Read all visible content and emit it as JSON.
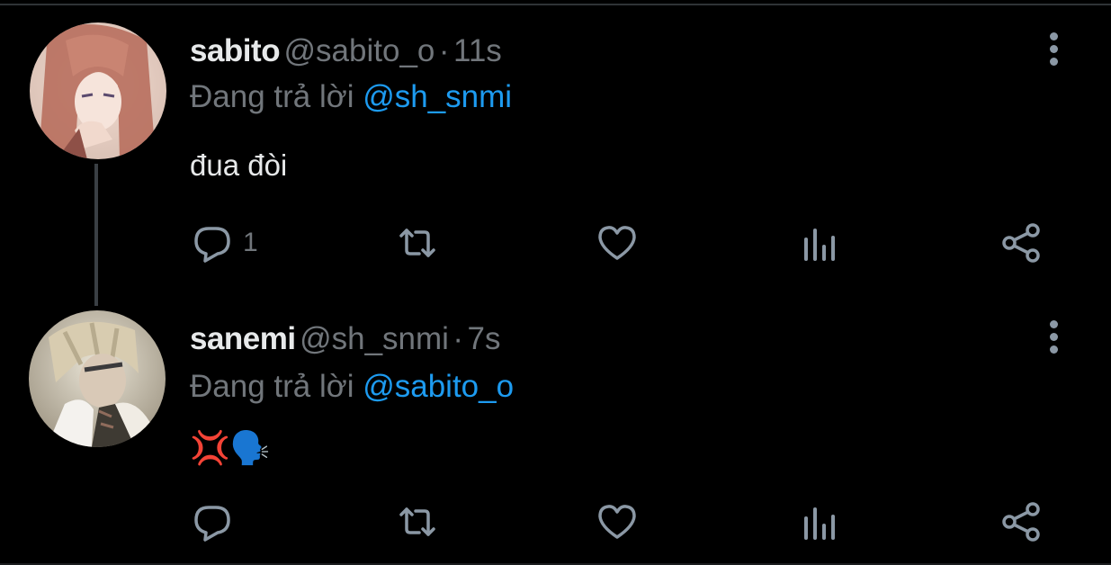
{
  "tweets": [
    {
      "name": "sabito",
      "handle": "@sabito_o",
      "separator": "·",
      "time": "11s",
      "reply_prefix": "Đang trả lời",
      "reply_to": "@sh_snmi",
      "text": "đua đòi",
      "actions": {
        "reply_count": "1",
        "retweet_count": "",
        "like_count": ""
      }
    },
    {
      "name": "sanemi",
      "handle": "@sh_snmi",
      "separator": "·",
      "time": "7s",
      "reply_prefix": "Đang trả lời",
      "reply_to": "@sabito_o",
      "text": "💢🗣️",
      "actions": {
        "reply_count": "",
        "retweet_count": "",
        "like_count": ""
      }
    }
  ],
  "icons": {
    "reply": "reply-icon",
    "retweet": "retweet-icon",
    "like": "heart-icon",
    "analytics": "analytics-icon",
    "share": "share-icon",
    "more": "more-vertical-icon"
  },
  "colors": {
    "background": "#000000",
    "text_primary": "#e7e9ea",
    "text_secondary": "#71767b",
    "mention": "#1d9bf0",
    "icon": "#8b98a5"
  }
}
